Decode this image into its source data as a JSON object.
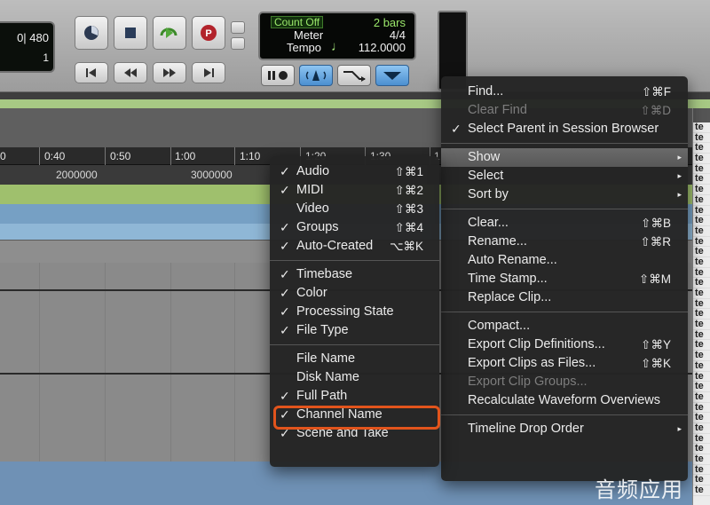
{
  "counter": {
    "line1": "0| 480",
    "line2": "1"
  },
  "lcd": {
    "count_off": "Count Off",
    "bars": "2 bars",
    "meter_label": "Meter",
    "meter_value": "4/4",
    "tempo_label": "Tempo",
    "tempo_note": "♩",
    "tempo_value": "112.0000"
  },
  "ruler": {
    "times": [
      "0",
      "0:40",
      "0:50",
      "1:00",
      "1:10",
      "1:20",
      "1:30",
      "1"
    ]
  },
  "samples": [
    "2000000",
    "3000000"
  ],
  "main_menu": {
    "items": [
      {
        "label": "Find...",
        "shortcut": "⇧⌘F",
        "enabled": true,
        "checked": false
      },
      {
        "label": "Clear Find",
        "shortcut": "⇧⌘D",
        "enabled": false,
        "checked": false
      },
      {
        "label": "Select Parent in Session Browser",
        "shortcut": "",
        "enabled": true,
        "checked": true
      },
      {
        "label": "Show",
        "shortcut": "",
        "enabled": true,
        "checked": false,
        "submenu": true,
        "highlighted": true
      },
      {
        "label": "Select",
        "shortcut": "",
        "enabled": true,
        "checked": false,
        "submenu": true
      },
      {
        "label": "Sort by",
        "shortcut": "",
        "enabled": true,
        "checked": false,
        "submenu": true
      },
      {
        "label": "Clear...",
        "shortcut": "⇧⌘B",
        "enabled": true,
        "checked": false
      },
      {
        "label": "Rename...",
        "shortcut": "⇧⌘R",
        "enabled": true,
        "checked": false
      },
      {
        "label": "Auto Rename...",
        "shortcut": "",
        "enabled": true,
        "checked": false
      },
      {
        "label": "Time Stamp...",
        "shortcut": "⇧⌘M",
        "enabled": true,
        "checked": false
      },
      {
        "label": "Replace Clip...",
        "shortcut": "",
        "enabled": true,
        "checked": false
      },
      {
        "label": "Compact...",
        "shortcut": "",
        "enabled": true,
        "checked": false
      },
      {
        "label": "Export Clip Definitions...",
        "shortcut": "⇧⌘Y",
        "enabled": true,
        "checked": false
      },
      {
        "label": "Export Clips as Files...",
        "shortcut": "⇧⌘K",
        "enabled": true,
        "checked": false
      },
      {
        "label": "Export Clip Groups...",
        "shortcut": "",
        "enabled": false,
        "checked": false
      },
      {
        "label": "Recalculate Waveform Overviews",
        "shortcut": "",
        "enabled": true,
        "checked": false
      },
      {
        "label": "Timeline Drop Order",
        "shortcut": "",
        "enabled": true,
        "checked": false,
        "submenu": true
      }
    ]
  },
  "show_menu": {
    "items": [
      {
        "label": "Audio",
        "shortcut": "⇧⌘1",
        "checked": true
      },
      {
        "label": "MIDI",
        "shortcut": "⇧⌘2",
        "checked": true
      },
      {
        "label": "Video",
        "shortcut": "⇧⌘3",
        "checked": false
      },
      {
        "label": "Groups",
        "shortcut": "⇧⌘4",
        "checked": true
      },
      {
        "label": "Auto-Created",
        "shortcut": "⌥⌘K",
        "checked": true
      },
      {
        "label": "Timebase",
        "shortcut": "",
        "checked": true
      },
      {
        "label": "Color",
        "shortcut": "",
        "checked": true
      },
      {
        "label": "Processing State",
        "shortcut": "",
        "checked": true
      },
      {
        "label": "File Type",
        "shortcut": "",
        "checked": true
      },
      {
        "label": "File Name",
        "shortcut": "",
        "checked": false
      },
      {
        "label": "Disk Name",
        "shortcut": "",
        "checked": false
      },
      {
        "label": "Full Path",
        "shortcut": "",
        "checked": true
      },
      {
        "label": "Channel Name",
        "shortcut": "",
        "checked": true
      },
      {
        "label": "Scene and Take",
        "shortcut": "",
        "checked": true
      }
    ]
  },
  "check_glyph": "✓",
  "cliplist_glyph": "te",
  "watermark": "音频应用",
  "colors": {
    "accent_highlight": "#e2541c",
    "lcd_green": "#9be86b",
    "mode_blue": "#4b8fd0"
  }
}
